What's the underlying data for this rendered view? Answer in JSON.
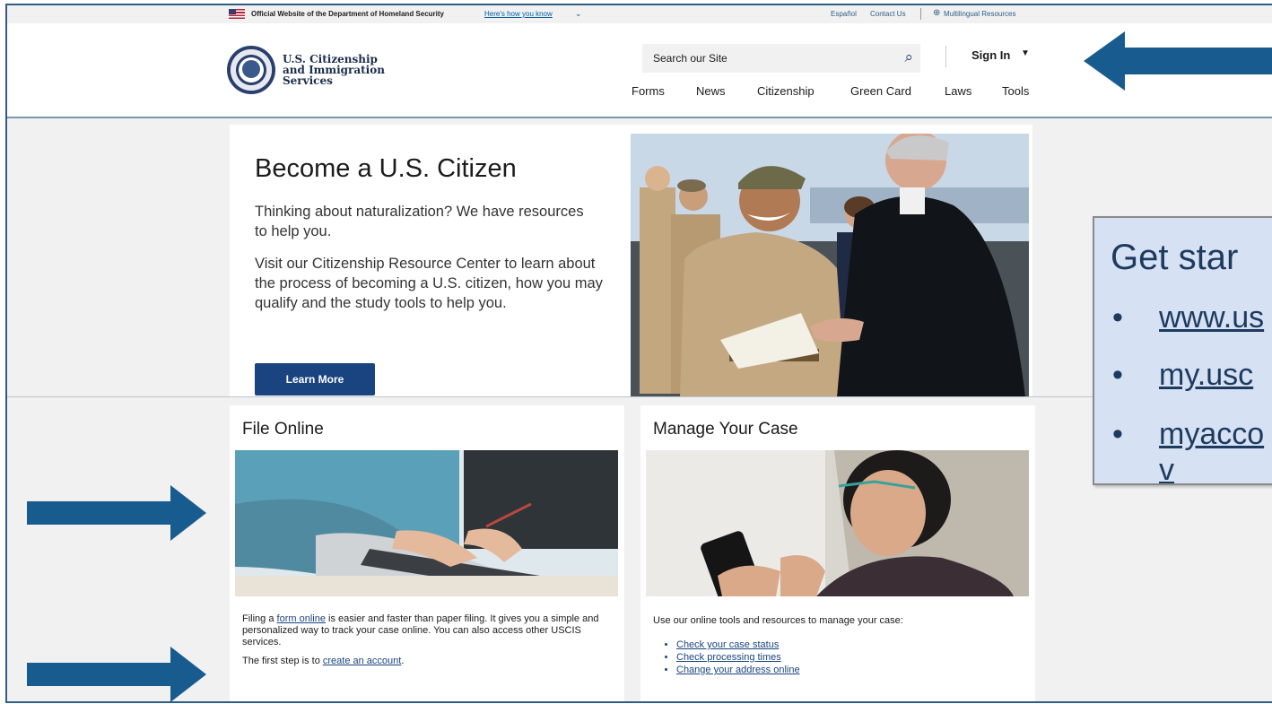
{
  "topbar": {
    "official_text": "Official Website of the Department of Homeland Security",
    "how_know_link": "Here's how you know",
    "espanol": "Español",
    "contact": "Contact Us",
    "multilingual": "Multilingual Resources"
  },
  "header": {
    "brand_line1": "U.S. Citizenship",
    "brand_line2": "and Immigration",
    "brand_line3": "Services",
    "search_placeholder": "Search our Site",
    "sign_in": "Sign In",
    "nav": [
      "Forms",
      "News",
      "Citizenship",
      "Green Card",
      "Laws",
      "Tools"
    ]
  },
  "hero": {
    "title": "Become a U.S. Citizen",
    "paragraph1": "Thinking about naturalization? We have resources to help you.",
    "paragraph2": "Visit our Citizenship Resource Center to learn about the process of becoming a U.S. citizen, how you may qualify and the study tools to help you.",
    "button": "Learn More"
  },
  "file_online": {
    "title": "File Online",
    "text_before": "Filing a ",
    "link1": "form online",
    "text_after": " is easier and faster than paper filing. It gives you a simple and personalized way to track your case online. You can also access other USCIS services.",
    "first_step_before": "The first step is to ",
    "link2": "create an account",
    "first_step_after": "."
  },
  "manage_case": {
    "title": "Manage Your Case",
    "intro": "Use our online tools and resources to manage your case:",
    "links": [
      "Check your case status",
      "Check processing times",
      "Change your address online"
    ]
  },
  "overlay": {
    "title": "Get star",
    "items": [
      "www.us",
      "my.usc",
      "myacco"
    ],
    "wrap": "v",
    "bullet": "•"
  },
  "colors": {
    "primary_blue": "#1a4480",
    "arrow_blue": "#185b8f",
    "overlay_bg": "#d6e1f3"
  }
}
